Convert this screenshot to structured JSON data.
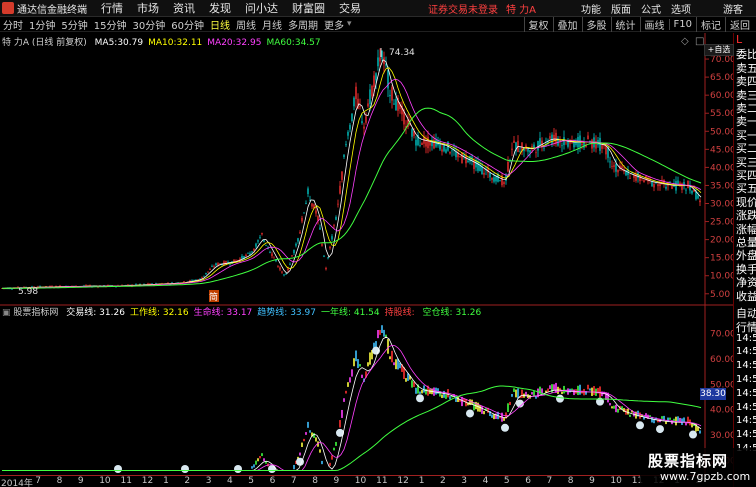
{
  "menubar": {
    "brand": "通达信金融终端",
    "items": [
      "行情",
      "市场",
      "资讯",
      "发现",
      "问小达",
      "财富圈",
      "交易"
    ],
    "status_text": "证券交易未登录",
    "stock_label": "特 力A",
    "right_items": [
      "功能",
      "版面",
      "公式",
      "选项",
      "游客"
    ]
  },
  "toolbar": {
    "periods": [
      "分时",
      "1分钟",
      "5分钟",
      "15分钟",
      "30分钟",
      "60分钟",
      "日线",
      "周线",
      "月线",
      "多周期",
      "更多"
    ],
    "active_period": "日线",
    "tools": [
      "复权",
      "叠加",
      "多股",
      "统计",
      "画线",
      "F10",
      "标记",
      "返回"
    ]
  },
  "main_chart": {
    "title": "特 力A (日线 前复权)",
    "ma": [
      {
        "label": "MA5:",
        "value": "30.79",
        "color": "#ffffff"
      },
      {
        "label": "MA10:",
        "value": "32.11",
        "color": "#ffff00"
      },
      {
        "label": "MA20:",
        "value": "32.95",
        "color": "#ff40ff"
      },
      {
        "label": "MA60:",
        "value": "34.57",
        "color": "#40ff40"
      }
    ],
    "high_label": "74.34",
    "low_label": "5.98",
    "mark_label": "简",
    "y_ticks": [
      "70.00",
      "65.00",
      "60.00",
      "55.00",
      "50.00",
      "45.00",
      "40.00",
      "35.00",
      "30.00",
      "25.00",
      "20.00",
      "15.00",
      "10.00",
      "5.00"
    ]
  },
  "indicator": {
    "name": "股票指标网",
    "lines": [
      {
        "label": "交易线:",
        "value": "31.26",
        "color": "#ffffff"
      },
      {
        "label": "工作线:",
        "value": "32.16",
        "color": "#ffff00"
      },
      {
        "label": "生命线:",
        "value": "33.17",
        "color": "#ff40ff"
      },
      {
        "label": "趋势线:",
        "value": "33.97",
        "color": "#40c0ff"
      },
      {
        "label": "一年线:",
        "value": "41.54",
        "color": "#40ff40"
      },
      {
        "label": "持股线:",
        "value": "",
        "color": "#ff4040"
      },
      {
        "label": "空仓线:",
        "value": "31.26",
        "color": "#40ff40"
      }
    ],
    "y_ticks": [
      "70.00",
      "60.00",
      "50.00",
      "40.00",
      "30.00",
      "20.00"
    ],
    "current_price": "38.30"
  },
  "x_axis": [
    "2014年",
    "7",
    "8",
    "9",
    "10",
    "11",
    "12",
    "1",
    "2",
    "3",
    "4",
    "5",
    "6",
    "7",
    "8",
    "9",
    "10",
    "11",
    "12",
    "1",
    "2",
    "3",
    "4",
    "5",
    "6",
    "7",
    "8",
    "9",
    "10",
    "11",
    "12",
    "1",
    "2"
  ],
  "right_panel": {
    "top": [
      "L",
      "委比",
      "卖五",
      "卖四",
      "卖三",
      "卖二",
      "卖一",
      "买一",
      "买二",
      "买三",
      "买四",
      "买五",
      "现价",
      "涨跌",
      "涨幅",
      "总量",
      "外盘",
      "换手",
      "净资",
      "收益"
    ],
    "bottom": [
      "自动",
      "行情",
      "14:5",
      "14:5",
      "14:5",
      "14:5",
      "14:5",
      "14:5",
      "14:5",
      "14:5",
      "14:5"
    ]
  },
  "watermark": {
    "title": "股票指标网",
    "url": "www.7gpzb.com"
  },
  "colors": {
    "up": "#ff3030",
    "down": "#00c8c8",
    "ma5": "#ffffff",
    "ma10": "#ffff00",
    "ma20": "#ff40ff",
    "ma60": "#40ff40"
  }
}
